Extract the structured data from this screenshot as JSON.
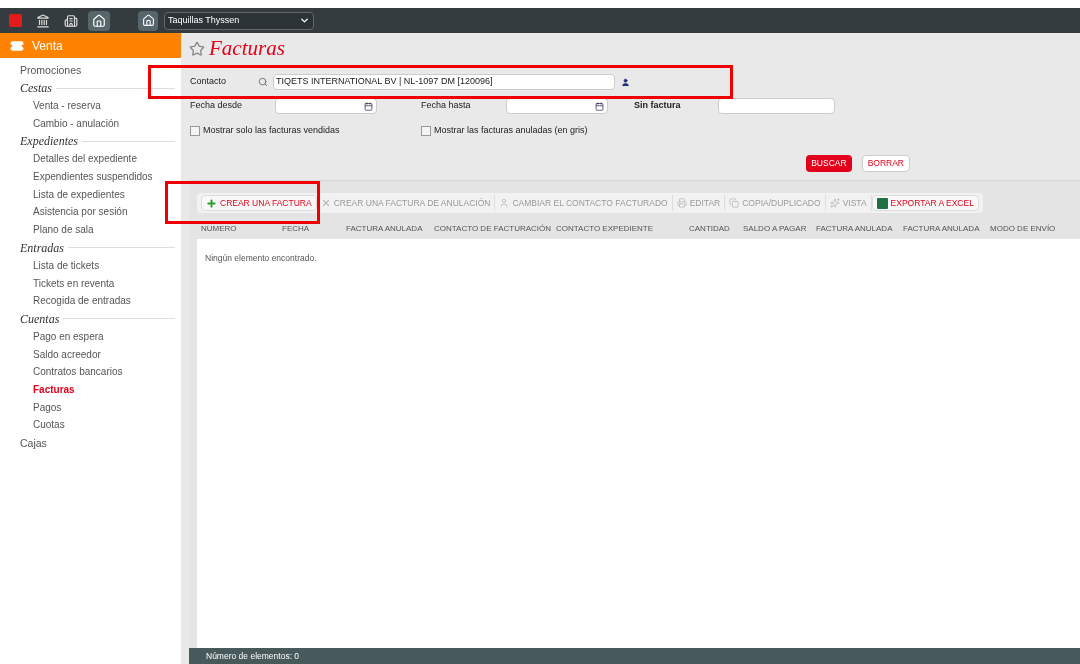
{
  "topbar": {
    "icons": [
      {
        "kind": "square",
        "selected": false
      },
      {
        "kind": "bank",
        "selected": false
      },
      {
        "kind": "building",
        "selected": false
      },
      {
        "kind": "home",
        "selected": true
      }
    ],
    "venue_select": {
      "value": "Taquillas Thyssen"
    }
  },
  "sidebar": {
    "section": "Venta",
    "items": [
      {
        "kind": "link",
        "label": "Promociones",
        "selected": false
      },
      {
        "kind": "group",
        "label": "Cestas",
        "children": [
          {
            "label": "Venta - reserva",
            "selected": false
          },
          {
            "label": "Cambio - anulación",
            "selected": false
          }
        ]
      },
      {
        "kind": "group",
        "label": "Expedientes",
        "children": [
          {
            "label": "Detalles del expediente",
            "selected": false
          },
          {
            "label": "Expendientes suspendidos",
            "selected": false
          },
          {
            "label": "Lista de expedientes",
            "selected": false
          },
          {
            "label": "Asistencia por sesión",
            "selected": false
          },
          {
            "label": "Plano de sala",
            "selected": false
          }
        ]
      },
      {
        "kind": "group",
        "label": "Entradas",
        "children": [
          {
            "label": "Lista de tickets",
            "selected": false
          },
          {
            "label": "Tickets en reventa",
            "selected": false
          },
          {
            "label": "Recogida de entradas",
            "selected": false
          }
        ]
      },
      {
        "kind": "group",
        "label": "Cuentas",
        "children": [
          {
            "label": "Pago en espera",
            "selected": false
          },
          {
            "label": "Saldo acreedor",
            "selected": false
          },
          {
            "label": "Contratos bancarios",
            "selected": false
          },
          {
            "label": "Facturas",
            "selected": true
          },
          {
            "label": "Pagos",
            "selected": false
          },
          {
            "label": "Cuotas",
            "selected": false
          }
        ]
      },
      {
        "kind": "link",
        "label": "Cajas",
        "selected": false
      }
    ]
  },
  "page": {
    "title": "Facturas"
  },
  "filters": {
    "contact": {
      "label": "Contacto",
      "value": "TIQETS INTERNATIONAL BV | NL-1097 DM [120096]",
      "highlighted": true
    },
    "date_from": {
      "label": "Fecha desde"
    },
    "date_to": {
      "label": "Fecha hasta"
    },
    "no_invoice": {
      "label": "Sin factura"
    },
    "checkboxes": [
      {
        "label": "Mostrar solo las facturas vendidas",
        "checked": false
      },
      {
        "label": "Mostrar las facturas anuladas (en gris)",
        "checked": false
      }
    ],
    "buttons": [
      {
        "label": "BUSCAR",
        "kind": "primary"
      },
      {
        "label": "BORRAR",
        "kind": "secondary"
      }
    ]
  },
  "toolbar": [
    {
      "label": "CREAR UNA FACTURA",
      "kind": "plus",
      "disabled": false,
      "highlighted": true
    },
    {
      "label": "CREAR UNA FACTURA DE ANULACIÓN",
      "kind": "cross",
      "disabled": true,
      "highlighted": false
    },
    {
      "label": "CAMBIAR EL CONTACTO FACTURADO",
      "kind": "user",
      "disabled": true,
      "highlighted": false
    },
    {
      "label": "EDITAR",
      "kind": "printer",
      "disabled": true,
      "highlighted": false
    },
    {
      "label": "COPIA/DUPLICADO",
      "kind": "copy",
      "disabled": true,
      "highlighted": false
    },
    {
      "label": "VISTA",
      "kind": "sparkle",
      "disabled": true,
      "highlighted": false
    },
    {
      "label": "EXPORTAR A EXCEL",
      "kind": "excel",
      "disabled": false,
      "highlighted": false
    }
  ],
  "table": {
    "columns": [
      "NUMERO",
      "FECHA",
      "FACTURA ANULADA",
      "CONTACTO DE FACTURACIÓN",
      "CONTACTO EXPEDIENTE",
      "CANTIDAD",
      "SALDO A PAGAR",
      "FACTURA ANULADA",
      "FACTURA ANULADA",
      "MODO DE ENVÍO"
    ],
    "empty_message": "Ningún elemento encontrado."
  },
  "status_bar": "Número de elementos: 0"
}
